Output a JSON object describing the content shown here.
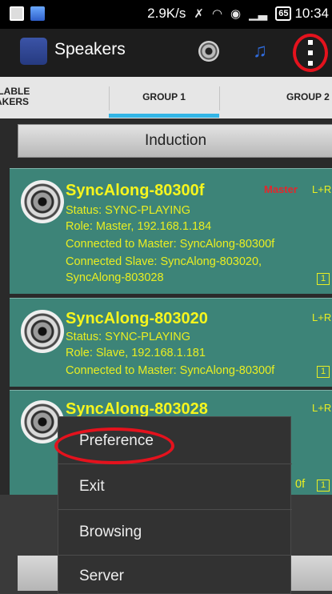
{
  "status_bar": {
    "speed": "2.9K/s",
    "battery": "65",
    "time": "10:34"
  },
  "action_bar": {
    "title": "Speakers"
  },
  "tabs": [
    {
      "label": "AVAILABLE SPEAKERS",
      "line1": "ILABLE",
      "line2": "AKERS"
    },
    {
      "label": "GROUP 1",
      "selected": true
    },
    {
      "label": "GROUP 2"
    }
  ],
  "induction_label": "Induction",
  "devices": [
    {
      "name": "SyncAlong-80300f",
      "status": "Status: SYNC-PLAYING",
      "role": "Role: Master,  192.168.1.184",
      "connected": "Connected to Master: SyncAlong-80300f",
      "slaves_1": "Connected Slave: SyncAlong-803020,",
      "slaves_2": "SyncAlong-803028",
      "master_tag": "Master",
      "channel": "L+R",
      "badge": "1"
    },
    {
      "name": "SyncAlong-803020",
      "status": "Status: SYNC-PLAYING",
      "role": "Role: Slave,  192.168.1.181",
      "connected": "Connected to Master: SyncAlong-80300f",
      "channel": "L+R",
      "badge": "1"
    },
    {
      "name": "SyncAlong-803028",
      "partial_text": "0f",
      "channel": "L+R",
      "badge": "1"
    }
  ],
  "menu": {
    "items": [
      "Preference",
      "Exit",
      "Browsing",
      "Server"
    ]
  },
  "colors": {
    "accent": "#33b5e5",
    "card": "#3d8478",
    "device_text": "#f6f51e",
    "master_red": "#e3272c",
    "annotation_red": "#e4121d"
  }
}
